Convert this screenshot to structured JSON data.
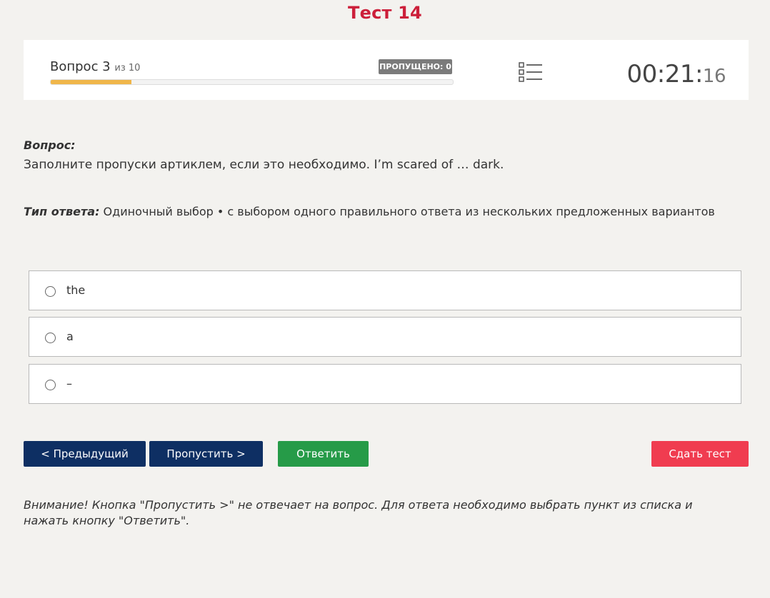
{
  "page": {
    "title": "Тест 14"
  },
  "header": {
    "question_label": "Вопрос 3",
    "question_of": "из 10",
    "skipped_badge": "ПРОПУЩЕНО: 0",
    "progress": 0.2,
    "timer_main": "00:21:",
    "timer_seconds": "16",
    "progress_color": "#f0b64a"
  },
  "question": {
    "label": "Вопрос:",
    "text": "Заполните пропуски артиклем, если это необходимо. I’m scared of … dark."
  },
  "answer_type": {
    "label": "Тип ответа:",
    "value": " Одиночный выбор • с выбором одного правильного ответа из нескольких предложенных вариантов"
  },
  "options": [
    {
      "label": "the"
    },
    {
      "label": "a"
    },
    {
      "label": "–"
    }
  ],
  "buttons": {
    "prev": "< Предыдущий",
    "skip": "Пропустить >",
    "answer": "Ответить",
    "submit": "Сдать тест"
  },
  "colors": {
    "title": "#cc1f3a",
    "nav_button": "#0e2f63",
    "answer_button": "#269b48",
    "submit_button": "#f03c50"
  },
  "warning": "Внимание! Кнопка \"Пропустить >\" не отвечает на вопрос. Для ответа необходимо выбрать пункт из списка и нажать кнопку \"Ответить\"."
}
